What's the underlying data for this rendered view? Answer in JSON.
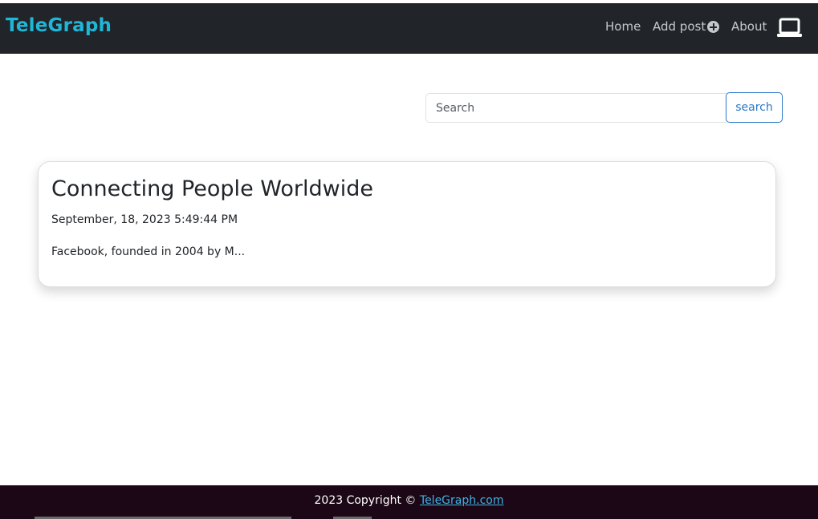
{
  "navbar": {
    "brand": "TeleGraph",
    "links": [
      {
        "label": "Home"
      },
      {
        "label": "Add post"
      },
      {
        "label": "About"
      }
    ],
    "brand_color": "#1fb6d8",
    "background": "#212529",
    "icons": [
      "plus-circle-icon",
      "laptop-icon"
    ]
  },
  "search": {
    "placeholder": "Search",
    "value": "",
    "button_label": "search"
  },
  "posts": [
    {
      "title": "Connecting People Worldwide",
      "date": "September, 18, 2023 5:49:44 PM",
      "excerpt": "Facebook, founded in 2004 by M..."
    }
  ],
  "footer": {
    "text": "2023 Copyright ©",
    "link": "TeleGraph.com",
    "background": "#1c0716",
    "link_color": "#3db3e6"
  }
}
